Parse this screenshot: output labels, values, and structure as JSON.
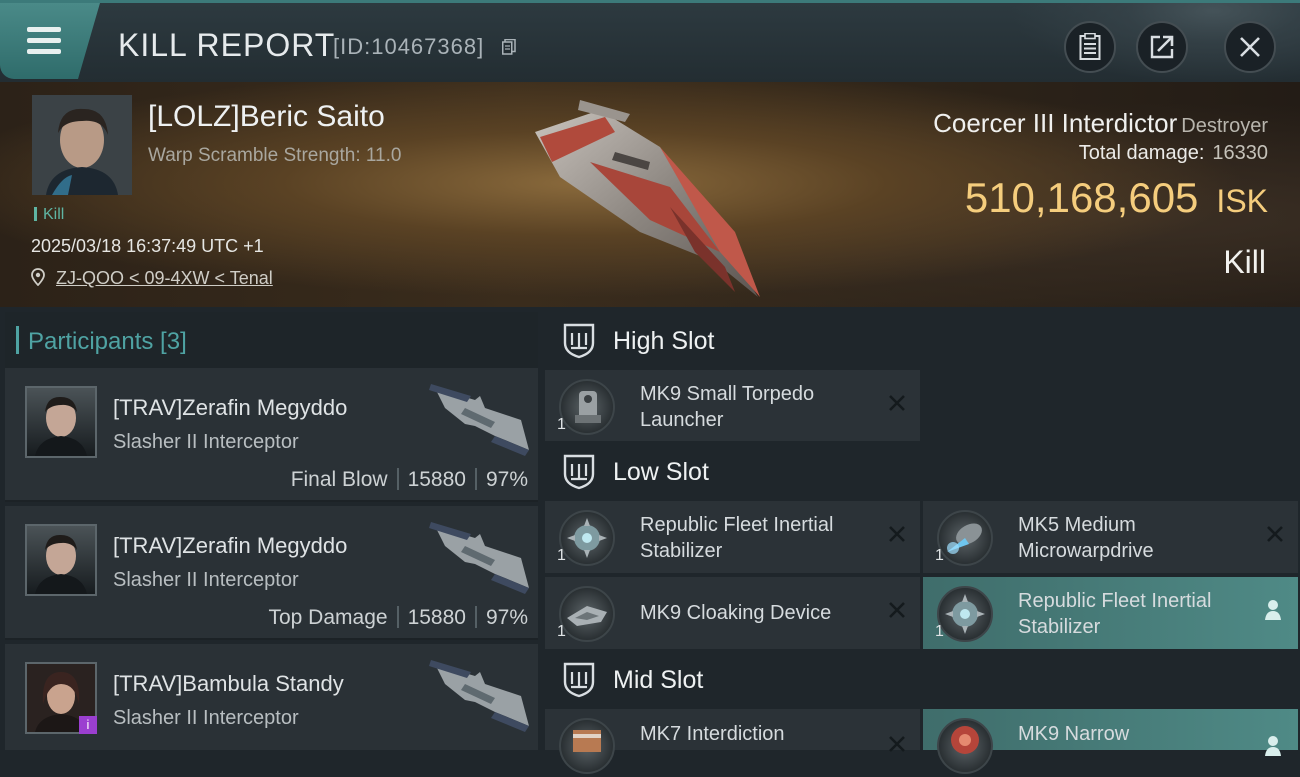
{
  "header": {
    "title": "KILL REPORT",
    "report_id": "[ID:10467368]"
  },
  "victim": {
    "name": "[LOLZ]Beric Saito",
    "warp_scramble": "Warp Scramble Strength: 11.0",
    "tag": "Kill",
    "datetime": "2025/03/18 16:37:49 UTC +1",
    "location": "ZJ-QOO < 09-4XW < Tenal",
    "ship_name": "Coercer III Interdictor",
    "ship_class": "Destroyer",
    "damage_label": "Total damage:",
    "damage_value": "16330",
    "isk_value": "510,168,605",
    "isk_unit": "ISK",
    "result": "Kill"
  },
  "participants": {
    "label": "Participants [3]",
    "items": [
      {
        "name": "[TRAV]Zerafin Megyddo",
        "ship": "Slasher II Interceptor",
        "role": "Final Blow",
        "damage": "15880",
        "percent": "97%"
      },
      {
        "name": "[TRAV]Zerafin Megyddo",
        "ship": "Slasher II Interceptor",
        "role": "Top Damage",
        "damage": "15880",
        "percent": "97%"
      },
      {
        "name": "[TRAV]Bambula Standy",
        "ship": "Slasher II Interceptor",
        "badge": "i"
      }
    ]
  },
  "slots": {
    "high": {
      "label": "High Slot",
      "modules": [
        {
          "name": "MK9 Small Torpedo Launcher",
          "qty": "1"
        }
      ]
    },
    "low": {
      "label": "Low Slot",
      "modules": [
        {
          "name": "Republic Fleet Inertial Stabilizer",
          "qty": "1"
        },
        {
          "name": "MK5 Medium Microwarpdrive",
          "qty": "1"
        },
        {
          "name": "MK9 Cloaking Device",
          "qty": "1"
        },
        {
          "name": "Republic Fleet Inertial Stabilizer",
          "qty": "1"
        }
      ]
    },
    "mid": {
      "label": "Mid Slot",
      "modules": [
        {
          "name": "MK7 Interdiction"
        },
        {
          "name": "MK9 Narrow"
        }
      ]
    }
  },
  "colors": {
    "accent": "#4fa3a3",
    "isk": "#f5cd7d",
    "highlight": "#4f8a86"
  }
}
